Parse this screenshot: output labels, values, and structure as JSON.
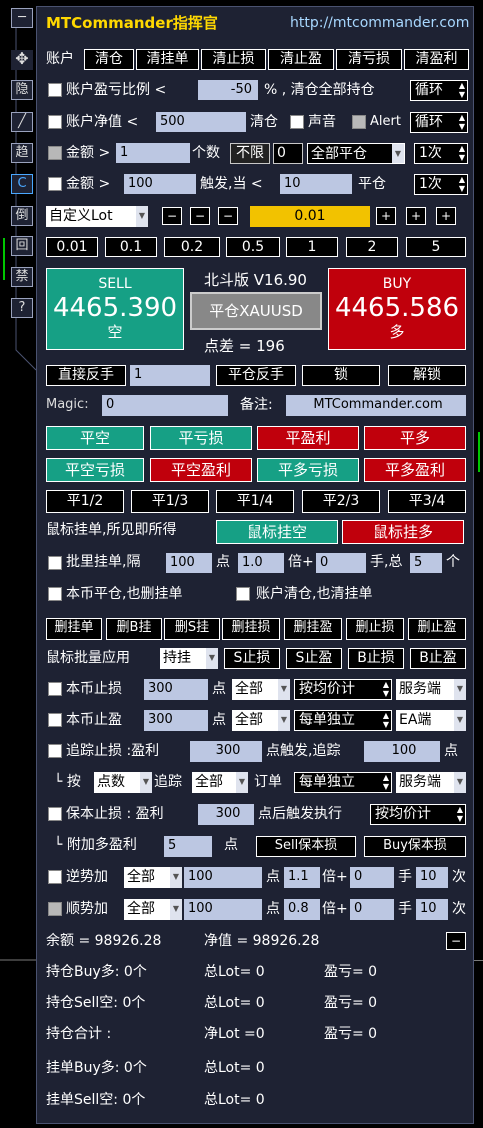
{
  "header": {
    "title": "MTCommander指挥官",
    "url": "http://mtcommander.com"
  },
  "side": [
    "─",
    "✥",
    "隐",
    "╱",
    "趋",
    "C",
    "倒",
    "回",
    "禁",
    "?"
  ],
  "row1": {
    "label": "账户",
    "buttons": [
      "清仓",
      "清挂单",
      "清止损",
      "清止盈",
      "清亏损",
      "清盈利"
    ]
  },
  "row2": {
    "label": "账户盈亏比例 <",
    "value": "-50",
    "suffix": "% , 清仓全部持仓",
    "mode": "循环"
  },
  "row3": {
    "label": "账户净值 <",
    "value": "500",
    "mid": "清仓",
    "sound": "声音",
    "alert": "Alert",
    "mode": "循环"
  },
  "row4": {
    "label": "金额 >",
    "value": "1",
    "count_label": "个数",
    "unlimited": "不限",
    "count": "0",
    "scope": "全部平仓",
    "times": "1次"
  },
  "row5": {
    "label": "金额 >",
    "value": "100",
    "trig": "触发,当 <",
    "value2": "10",
    "act": "平仓",
    "times": "1次"
  },
  "lot": {
    "mode": "自定义Lot",
    "minus": "−",
    "value": "0.01",
    "plus": "+",
    "presets": [
      "0.01",
      "0.1",
      "0.2",
      "0.5",
      "1",
      "2",
      "5"
    ]
  },
  "trade": {
    "sell_label": "SELL",
    "sell_price": "4465.390",
    "sell_sub": "空",
    "version": "北斗版 V16.90",
    "close_label": "平仓XAUUSD",
    "spread_label": "点差 = ",
    "spread": "196",
    "buy_label": "BUY",
    "buy_price": "4465.586",
    "buy_sub": "多"
  },
  "reverse": {
    "direct": "直接反手",
    "value": "1",
    "close_rev": "平仓反手",
    "lock": "锁",
    "unlock": "解锁"
  },
  "magic": {
    "label": "Magic:",
    "value": "0",
    "note_label": "备注:",
    "note": "MTCommander.com"
  },
  "closeRow1": [
    "平空",
    "平亏损",
    "平盈利",
    "平多"
  ],
  "closeRow2": [
    "平空亏损",
    "平空盈利",
    "平多亏损",
    "平多盈利"
  ],
  "partial": [
    "平1/2",
    "平1/3",
    "平1/4",
    "平2/3",
    "平3/4"
  ],
  "mouse": {
    "label": "鼠标挂单,所见即所得",
    "sell": "鼠标挂空",
    "buy": "鼠标挂多"
  },
  "batch": {
    "label": "批里挂单,隔",
    "pts": "100",
    "pt": "点",
    "mult": "1.0",
    "bei": "倍+",
    "hand": "0",
    "shou": "手,总",
    "total": "5",
    "ge": "个"
  },
  "opts": {
    "a": "本币平仓,也删挂单",
    "b": "账户清仓,也清挂单"
  },
  "delRow": [
    "删挂单",
    "删B挂",
    "删S挂",
    "删挂损",
    "删挂盈",
    "删止损",
    "删止盈"
  ],
  "apply": {
    "label": "鼠标批量应用",
    "mode": "持挂",
    "btns": [
      "S止损",
      "S止盈",
      "B止损",
      "B止盈"
    ]
  },
  "sl": {
    "label": "本币止损",
    "value": "300",
    "pt": "点",
    "scope": "全部",
    "method": "按均价计",
    "side": "服务端"
  },
  "tp": {
    "label": "本币止盈",
    "value": "300",
    "pt": "点",
    "scope": "全部",
    "method": "每单独立",
    "side": "EA端"
  },
  "trail": {
    "label": "追踪止损 :盈利",
    "value": "300",
    "mid": "点触发,追踪",
    "value2": "100",
    "pt": "点"
  },
  "trail2": {
    "arrow": "└ 按",
    "unit": "点数",
    "track": "追踪",
    "scope": "全部",
    "order": "订单",
    "method": "每单独立",
    "side": "服务端"
  },
  "be": {
    "label": "保本止损 : 盈利",
    "value": "300",
    "mid": "点后触发执行",
    "method": "按均价计"
  },
  "be2": {
    "label": "└ 附加多盈利",
    "value": "5",
    "pt": "点",
    "sell": "Sell保本损",
    "buy": "Buy保本损"
  },
  "counter": {
    "label": "逆势加",
    "scope": "全部",
    "value": "100",
    "pt": "点",
    "mult": "1.1",
    "bei": "倍+",
    "hand": "0",
    "shou": "手",
    "times": "10",
    "ci": "次"
  },
  "trend": {
    "label": "顺势加",
    "scope": "全部",
    "value": "100",
    "pt": "点",
    "mult": "0.8",
    "bei": "倍+",
    "hand": "0",
    "shou": "手",
    "times": "10",
    "ci": "次"
  },
  "summary": {
    "balance": "余额 = 98926.28",
    "equity": "净值 = 98926.28",
    "collapse": "−",
    "rows": [
      [
        "持仓Buy多:  0个",
        "总Lot= 0",
        "盈亏= 0"
      ],
      [
        "持仓Sell空:  0个",
        "总Lot= 0",
        "盈亏= 0"
      ],
      [
        "持仓合计 :",
        "净Lot =0",
        "盈亏= 0"
      ],
      [
        "挂单Buy多:  0个",
        "总Lot= 0",
        ""
      ],
      [
        "挂单Sell空:  0个",
        "总Lot= 0",
        ""
      ]
    ]
  },
  "colors": {
    "panel": "#1e2233",
    "green": "#16a085",
    "red": "#c0000c",
    "yellow": "#f2c200",
    "title": "#ffd800",
    "url": "#a8d8ff"
  }
}
